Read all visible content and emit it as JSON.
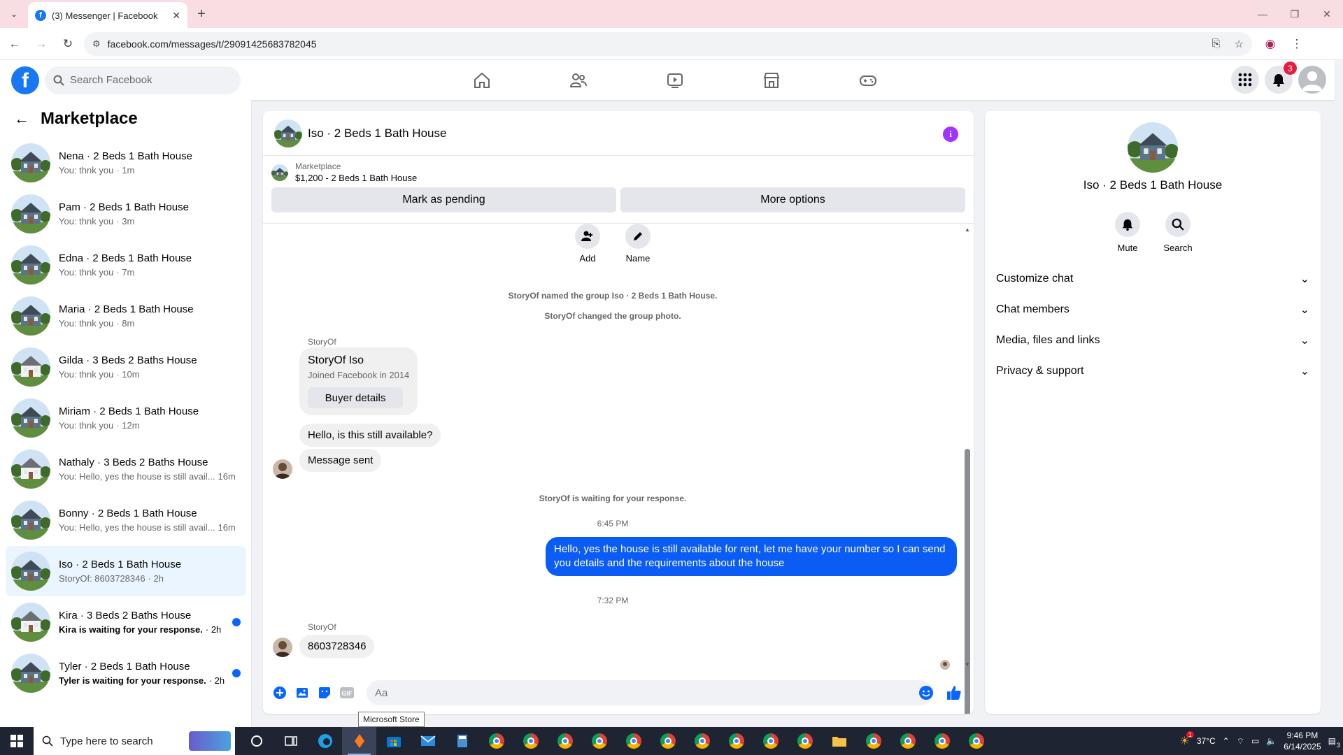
{
  "browser": {
    "tab_title": "(3) Messenger | Facebook",
    "url": "facebook.com/messages/t/29091425683782045"
  },
  "header": {
    "search_placeholder": "Search Facebook",
    "notifications_count": "3"
  },
  "sidebar": {
    "title": "Marketplace",
    "conversations": [
      {
        "name": "Nena · 2 Beds 1 Bath House",
        "preview": "You: thnk you",
        "time": "· 1m",
        "unread": false,
        "active": false,
        "house": "blue"
      },
      {
        "name": "Pam · 2 Beds 1 Bath House",
        "preview": "You: thnk you",
        "time": "· 3m",
        "unread": false,
        "active": false,
        "house": "blue"
      },
      {
        "name": "Edna · 2 Beds 1 Bath House",
        "preview": "You: thnk you",
        "time": "· 7m",
        "unread": false,
        "active": false,
        "house": "blue"
      },
      {
        "name": "Maria · 2 Beds 1 Bath House",
        "preview": "You: thnk you",
        "time": "· 8m",
        "unread": false,
        "active": false,
        "house": "blue"
      },
      {
        "name": "Gilda · 3 Beds 2 Baths House",
        "preview": "You: thnk you",
        "time": "· 10m",
        "unread": false,
        "active": false,
        "house": "white"
      },
      {
        "name": "Miriam · 2 Beds 1 Bath House",
        "preview": "You: thnk you",
        "time": "· 12m",
        "unread": false,
        "active": false,
        "house": "blue"
      },
      {
        "name": "Nathaly · 3 Beds 2 Baths House",
        "preview": "You: Hello, yes the house is still avail...",
        "time": "16m",
        "unread": false,
        "active": false,
        "house": "white"
      },
      {
        "name": "Bonny · 2 Beds 1 Bath House",
        "preview": "You: Hello, yes the house is still avail...",
        "time": "16m",
        "unread": false,
        "active": false,
        "house": "blue"
      },
      {
        "name": "Iso · 2 Beds 1 Bath House",
        "preview": "StoryOf: 8603728346",
        "time": "· 2h",
        "unread": false,
        "active": true,
        "house": "blue"
      },
      {
        "name": "Kira · 3 Beds 2 Baths House",
        "preview": "Kira is waiting for your response.",
        "time": "· 2h",
        "unread": true,
        "active": false,
        "house": "white"
      },
      {
        "name": "Tyler · 2 Beds 1 Bath House",
        "preview": "Tyler is waiting for your response.",
        "time": "· 2h",
        "unread": true,
        "active": false,
        "house": "blue"
      }
    ]
  },
  "chat": {
    "title": "Iso · 2 Beds 1 Bath House",
    "listing_category": "Marketplace",
    "listing_price": "$1,200 - 2 Beds 1 Bath House",
    "mark_pending_label": "Mark as pending",
    "more_options_label": "More options",
    "add_label": "Add",
    "name_label": "Name",
    "sys_named": "StoryOf named the group Iso · 2 Beds 1 Bath House.",
    "sys_photo": "StoryOf changed the group photo.",
    "sender_1": "StoryOf",
    "card_name": "StoryOf Iso",
    "card_joined": "Joined Facebook in 2014",
    "buyer_details_label": "Buyer details",
    "msg_available": "Hello, is this still available?",
    "msg_sent": "Message sent",
    "sys_waiting": "StoryOf is waiting for your response.",
    "time_1": "6:45 PM",
    "msg_me": "Hello, yes the house is still available for rent, let me have your number so I can send you details and the requirements about the house",
    "time_2": "7:32 PM",
    "sender_2": "StoryOf",
    "msg_number": "8603728346",
    "composer_placeholder": "Aa",
    "tooltip": "Microsoft Store"
  },
  "info_panel": {
    "title": "Iso · 2 Beds 1 Bath House",
    "mute_label": "Mute",
    "search_label": "Search",
    "sections": [
      "Customize chat",
      "Chat members",
      "Media, files and links",
      "Privacy & support"
    ]
  },
  "taskbar": {
    "search_placeholder": "Type here to search",
    "temperature": "37°C",
    "weather_badge": "1",
    "time": "9:46 PM",
    "date": "6/14/2025",
    "notif_count": "3"
  },
  "colors": {
    "brand": "#1877f2",
    "my_bubble": "#0a5cf5",
    "info_icon": "#a033ff",
    "unread_dot": "#0866ff"
  }
}
